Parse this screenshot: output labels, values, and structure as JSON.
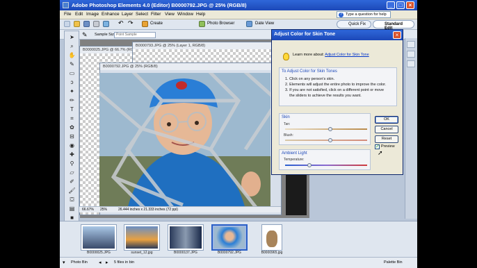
{
  "app": {
    "title": "Adobe Photoshop Elements 4.0 (Editor) B0000792.JPG @ 25% (RGB/8)",
    "window_controls": {
      "minimize": "_",
      "maximize": "□",
      "close": "×"
    }
  },
  "menu": [
    "File",
    "Edit",
    "Image",
    "Enhance",
    "Layer",
    "Select",
    "Filter",
    "View",
    "Window",
    "Help"
  ],
  "help_search": {
    "placeholder": "Type a question for help",
    "icon": "?"
  },
  "shortcuts": {
    "create": "Create",
    "photo_browser": "Photo Browser",
    "date_view": "Date View",
    "quick_fix": "Quick Fix",
    "standard_edit": "Standard Edit"
  },
  "options_bar": {
    "sample_size_label": "Sample Size:",
    "sample_size_value": "Point Sample"
  },
  "documents": {
    "back1_title": "B0000025.JPG @ 66.7% (RGB/8)",
    "back2_title": "B0000793.JPG @ 25% (Layer 1, RGB/8)",
    "front_title": "B0000792.JPG @ 25% (RGB/8)",
    "zoom_back": "66.67%",
    "zoom_front": "25%",
    "doc_size": "26.444 inches x 21.333 inches (72 ppi)"
  },
  "dialog": {
    "title": "Adjust Color for Skin Tone",
    "learn_prefix": "Learn more about:",
    "learn_link": "Adjust Color for Skin Tone",
    "instructions_header": "To Adjust Color for Skin Tones",
    "instructions": [
      "1. Click on any person's skin.",
      "2. Elements will adjust the entire photo to improve the color.",
      "3. If you are not satisfied, click on a different point or move",
      "    the sliders to achieve the results you want."
    ],
    "skin_header": "Skin",
    "tan_label": "Tan:",
    "tan_value": 0.55,
    "blush_label": "Blush:",
    "blush_value": 0.55,
    "ambient_header": "Ambient Light",
    "temperature_label": "Temperature:",
    "temperature_value": 0.3,
    "buttons": {
      "ok": "OK",
      "cancel": "Cancel",
      "reset": "Reset"
    },
    "preview_label": "Preview",
    "preview_checked": true
  },
  "photo_bin": {
    "thumbs": [
      {
        "label": "B0000025.JPG"
      },
      {
        "label": "sunset_12.jpg"
      },
      {
        "label": "B0000137.JPG"
      },
      {
        "label": "B0000792.JPG"
      },
      {
        "label": "B0000965.jpg"
      }
    ]
  },
  "bottom": {
    "photo_bin": "Photo Bin",
    "files_count": "5 files in bin",
    "palette_bin": "Palette Bin"
  }
}
